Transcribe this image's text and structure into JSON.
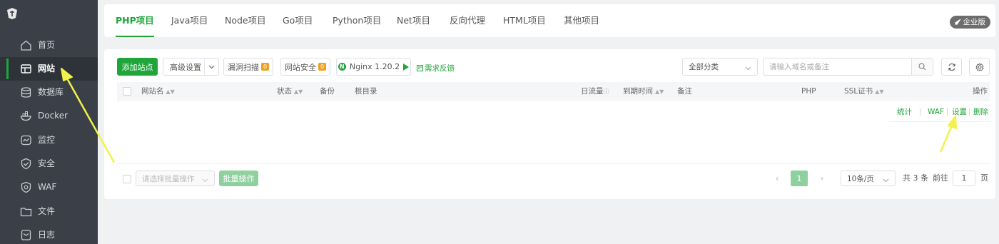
{
  "sidebar": {
    "items": [
      {
        "label": "首页",
        "icon": "home-icon"
      },
      {
        "label": "网站",
        "icon": "website-icon"
      },
      {
        "label": "数据库",
        "icon": "database-icon"
      },
      {
        "label": "Docker",
        "icon": "docker-icon"
      },
      {
        "label": "监控",
        "icon": "monitor-icon"
      },
      {
        "label": "安全",
        "icon": "security-icon"
      },
      {
        "label": "WAF",
        "icon": "waf-shield-icon"
      },
      {
        "label": "文件",
        "icon": "folder-icon"
      },
      {
        "label": "日志",
        "icon": "log-icon"
      }
    ],
    "active_index": 1
  },
  "tabs": [
    "PHP项目",
    "Java项目",
    "Node项目",
    "Go项目",
    "Python项目",
    "Net项目",
    "反向代理",
    "HTML项目",
    "其他项目"
  ],
  "active_tab": 0,
  "enterprise_badge": "企业版",
  "toolbar": {
    "add_site": "添加站点",
    "advanced": "高级设置",
    "vuln_scan": "漏洞扫描",
    "site_security": "网站安全",
    "badge_count": "0",
    "nginx": "Nginx 1.20.2",
    "feedback": "需求反馈",
    "category": "全部分类",
    "search_placeholder": "请输入域名或备注"
  },
  "table": {
    "headers": {
      "name": "网站名",
      "status": "状态",
      "backup": "备份",
      "root": "根目录",
      "traffic": "日流量",
      "expire": "到期时间",
      "remark": "备注",
      "php": "PHP",
      "ssl": "SSL证书",
      "actions": "操作"
    },
    "row_actions": [
      "统计",
      "WAF",
      "设置",
      "删除"
    ]
  },
  "footer": {
    "batch_placeholder": "请选择批量操作",
    "batch_button": "批量操作",
    "current_page": "1",
    "page_size": "10条/页",
    "total": "共 3 条",
    "goto_label": "前往",
    "goto_value": "1",
    "page_unit": "页"
  },
  "colors": {
    "sidebar_bg": "#3b4048",
    "accent_green": "#20a53a",
    "annotation_arrow": "#f2f24a"
  }
}
